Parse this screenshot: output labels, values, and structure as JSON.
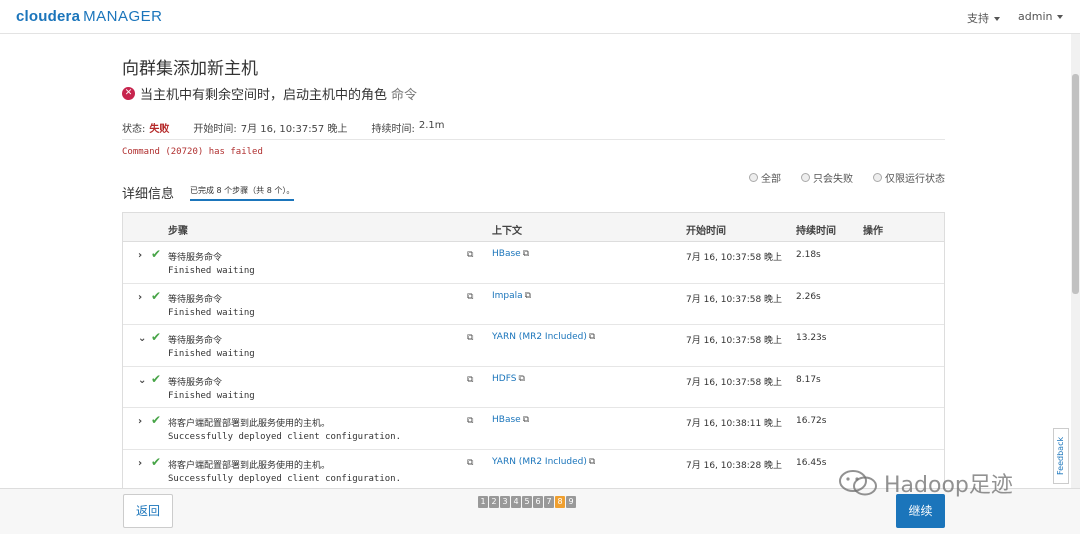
{
  "app": {
    "brand": "cloudera",
    "product": "MANAGER"
  },
  "nav": {
    "support": "支持",
    "user": "admin"
  },
  "page": {
    "title": "向群集添加新主机",
    "command_name": "当主机中有剩余空间时，启动主机中的角色",
    "command_suffix": "命令"
  },
  "status": {
    "label": "状态:",
    "value": "失败",
    "start_label": "开始时间:",
    "start_value": "7月 16, 10:37:57 晚上",
    "duration_label": "持续时间:",
    "duration_value": "2.1m"
  },
  "error_message": "Command (20720) has failed",
  "filters": {
    "all": "全部",
    "failed_only": "只会失败",
    "running_only": "仅限运行状态"
  },
  "details": {
    "label": "详细信息",
    "progress": "已完成 8 个步骤（共 8 个）。"
  },
  "table": {
    "headers": {
      "step": "步骤",
      "context": "上下文",
      "start_time": "开始时间",
      "duration": "持续时间",
      "actions": "操作"
    },
    "rows": [
      {
        "chevron": "›",
        "step": "等待服务命令",
        "detail": "Finished waiting",
        "context": "HBase",
        "start": "7月 16, 10:37:58 晚上",
        "duration": "2.18s"
      },
      {
        "chevron": "›",
        "step": "等待服务命令",
        "detail": "Finished waiting",
        "context": "Impala",
        "start": "7月 16, 10:37:58 晚上",
        "duration": "2.26s"
      },
      {
        "chevron": "⌄",
        "step": "等待服务命令",
        "detail": "Finished waiting",
        "context": "YARN (MR2 Included)",
        "start": "7月 16, 10:37:58 晚上",
        "duration": "13.23s"
      },
      {
        "chevron": "⌄",
        "step": "等待服务命令",
        "detail": "Finished waiting",
        "context": "HDFS",
        "start": "7月 16, 10:37:58 晚上",
        "duration": "8.17s"
      },
      {
        "chevron": "›",
        "step": "将客户端配置部署到此服务使用的主机。",
        "detail": "Successfully deployed client configuration.",
        "context": "HBase",
        "start": "7月 16, 10:38:11 晚上",
        "duration": "16.72s"
      },
      {
        "chevron": "›",
        "step": "将客户端配置部署到此服务使用的主机。",
        "detail": "Successfully deployed client configuration.",
        "context": "YARN (MR2 Included)",
        "start": "7月 16, 10:38:28 晚上",
        "duration": "16.45s"
      }
    ]
  },
  "footer": {
    "back": "返回",
    "next": "继续",
    "pages": [
      "1",
      "2",
      "3",
      "4",
      "5",
      "6",
      "7",
      "8",
      "9"
    ],
    "active_page": "8"
  },
  "feedback": "Feedback",
  "watermark": "Hadoop足迹",
  "colors": {
    "brand": "#1b75bb",
    "error": "#c7254e",
    "success": "#47a447",
    "active_page": "#f0a030"
  }
}
